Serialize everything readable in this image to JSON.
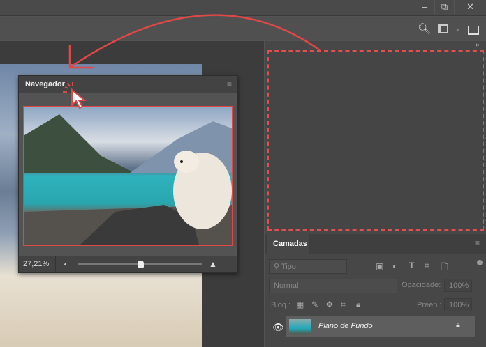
{
  "window": {
    "minimize": "‒",
    "restore": "⧉",
    "close": "✕"
  },
  "toolbar": {
    "search_icon": "search-icon",
    "workspace_icon": "workspace-icon",
    "share_icon": "share-icon",
    "chevron": "⌄"
  },
  "collapse_label": "»",
  "navigator": {
    "title": "Navegador",
    "zoom_value": "27,21%",
    "slider_percent": 50
  },
  "layers": {
    "tab": "Camadas",
    "filter_placeholder": "Tipo",
    "blend_mode": "Normal",
    "opacity_label": "Opacidade:",
    "opacity_value": "100%",
    "lock_label": "Bloq.:",
    "fill_label": "Preen.:",
    "fill_value": "100%",
    "items": [
      {
        "name": "Plano de Fundo",
        "visible": true,
        "locked": true
      }
    ]
  },
  "colors": {
    "annotation": "#e04848"
  }
}
